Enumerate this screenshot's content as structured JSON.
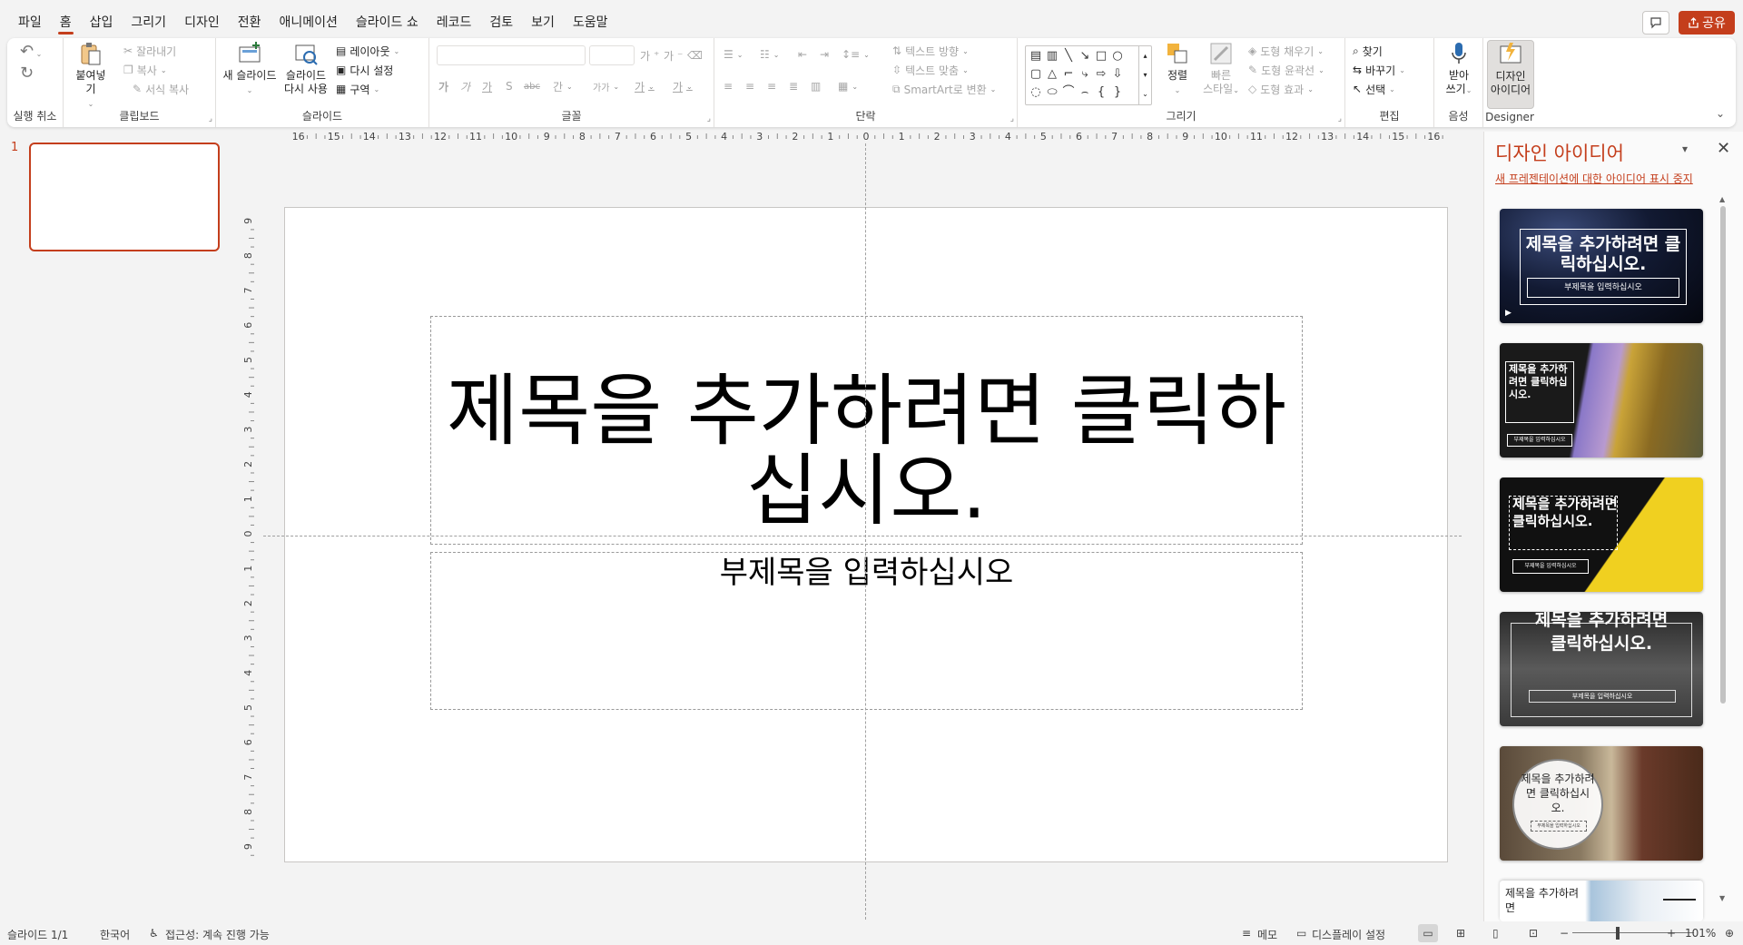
{
  "menu": {
    "tabs": [
      "파일",
      "홈",
      "삽입",
      "그리기",
      "디자인",
      "전환",
      "애니메이션",
      "슬라이드 쇼",
      "레코드",
      "검토",
      "보기",
      "도움말"
    ],
    "active_tab": "홈",
    "share_label": "공유"
  },
  "ribbon": {
    "undo_group": {
      "label": "실행 취소"
    },
    "clipboard": {
      "label": "클립보드",
      "paste": "붙여넣기",
      "cut": "잘라내기",
      "copy": "복사",
      "format_painter": "서식 복사"
    },
    "slides": {
      "label": "슬라이드",
      "new_slide": "새 슬라이드",
      "reuse_line1": "슬라이드",
      "reuse_line2": "다시 사용",
      "layout": "레이아웃",
      "reset": "다시 설정",
      "section": "구역"
    },
    "font": {
      "label": "글꼴",
      "font_name": "",
      "font_size": "",
      "grow": "가",
      "shrink": "가",
      "bold": "가",
      "italic": "가",
      "underline": "가",
      "shadow": "S",
      "strike": "abc",
      "spacing": "간",
      "case": "가가",
      "highlight": "가",
      "font_color": "가"
    },
    "paragraph": {
      "label": "단락",
      "text_direction": "텍스트 방향",
      "align_text": "텍스트 맞춤",
      "smartart": "SmartArt로 변환"
    },
    "drawing": {
      "label": "그리기",
      "arrange": "정렬",
      "quick_styles_line1": "빠른",
      "quick_styles_line2": "스타일",
      "fill": "도형 채우기",
      "outline": "도형 윤곽선",
      "effects": "도형 효과"
    },
    "editing": {
      "label": "편집",
      "find": "찾기",
      "replace": "바꾸기",
      "select": "선택"
    },
    "voice": {
      "label": "음성",
      "dictate_line1": "받아",
      "dictate_line2": "쓰기"
    },
    "designer": {
      "label": "Designer",
      "btn_line1": "디자인",
      "btn_line2": "아이디어"
    }
  },
  "thumbnails": [
    {
      "number": "1"
    }
  ],
  "slide": {
    "title_line1": "제목을 추가하려면 클릭하",
    "title_line2": "십시오.",
    "subtitle": "부제목을 입력하십시오"
  },
  "ruler": {
    "h_ticks": [
      "16",
      "15",
      "14",
      "13",
      "12",
      "11",
      "10",
      "9",
      "8",
      "7",
      "6",
      "5",
      "4",
      "3",
      "2",
      "1",
      "0",
      "1",
      "2",
      "3",
      "4",
      "5",
      "6",
      "7",
      "8",
      "9",
      "10",
      "11",
      "12",
      "13",
      "14",
      "15",
      "16"
    ],
    "v_ticks": [
      "9",
      "8",
      "7",
      "6",
      "5",
      "4",
      "3",
      "2",
      "1",
      "0",
      "1",
      "2",
      "3",
      "4",
      "5",
      "6",
      "7",
      "8",
      "9"
    ]
  },
  "designer_pane": {
    "title": "디자인 아이디어",
    "stop_link": "새 프레젠테이션에 대한 아이디어 표시 중지",
    "ideas": [
      {
        "title": "제목을 추가하려면 클릭하십시오.",
        "subtitle": "부제목을 입력하십시오"
      },
      {
        "title": "제목을 추가하려면 클릭하십시오.",
        "subtitle": "부제목을 입력하십시오"
      },
      {
        "title": "제목을 추가하려면 클릭하십시오.",
        "subtitle": "부제목을 입력하십시오"
      },
      {
        "title": "제목을 추가하려면 클릭하십시오.",
        "subtitle": "부제목을 입력하십시오"
      },
      {
        "title": "제목을 추가하려면 클릭하십시오.",
        "subtitle": "부제목을 입력하십시오"
      },
      {
        "title": "제목을 추가하려면",
        "subtitle": ""
      }
    ]
  },
  "status_bar": {
    "slide_count": "슬라이드 1/1",
    "language": "한국어",
    "accessibility": "접근성: 계속 진행 가능",
    "notes": "메모",
    "display_settings": "디스플레이 설정",
    "zoom": "101%"
  },
  "colors": {
    "accent": "#c43e1c",
    "ribbon_bg": "#ffffff",
    "app_bg": "#f3f3f3"
  }
}
